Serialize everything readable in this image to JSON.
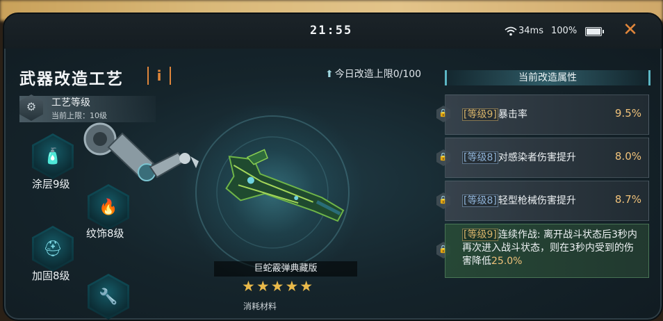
{
  "status": {
    "time": "21:55",
    "ping": "34ms",
    "battery": "100%"
  },
  "icons": {
    "close": "close-x-icon",
    "info": "info-icon",
    "wrench": "wrench-gear-icon",
    "lock": "lock-icon",
    "arrow": "up-arrow-icon"
  },
  "colors": {
    "accent_orange": "#e0863b",
    "value_gold": "#f0c27a",
    "teal": "#5cb6c4"
  },
  "header": {
    "title": "武器改造工艺",
    "info_label": "i",
    "daily_limit": "今日改造上限0/100"
  },
  "craft_level": {
    "title": "工艺等级",
    "sub": "当前上限：10级"
  },
  "mods": [
    {
      "label": "涂层9级",
      "icon": "spray-can-icon"
    },
    {
      "label": "纹饰8级",
      "icon": "flame-icon"
    },
    {
      "label": "加固8级",
      "icon": "welding-mask-icon"
    },
    {
      "label": "",
      "icon": "drill-icon"
    }
  ],
  "weapon": {
    "name": "巨蛇霰弹典藏版",
    "stars": "★★★★★",
    "consume_label": "消耗材料"
  },
  "attributes": {
    "header": "当前改造属性",
    "rows": [
      {
        "tag": "[等级9]",
        "name": "暴击率",
        "value": "9.5%"
      },
      {
        "tag": "[等级8]",
        "name": "对感染者伤害提升",
        "value": "8.0%"
      },
      {
        "tag": "[等级8]",
        "name": "轻型枪械伤害提升",
        "value": "8.7%"
      }
    ],
    "special": {
      "tag": "[等级9]",
      "text": "连续作战: 离开战斗状态后3秒内再次进入战斗状态，则在3秒内受到的伤害降低",
      "value": "25.0%"
    }
  }
}
